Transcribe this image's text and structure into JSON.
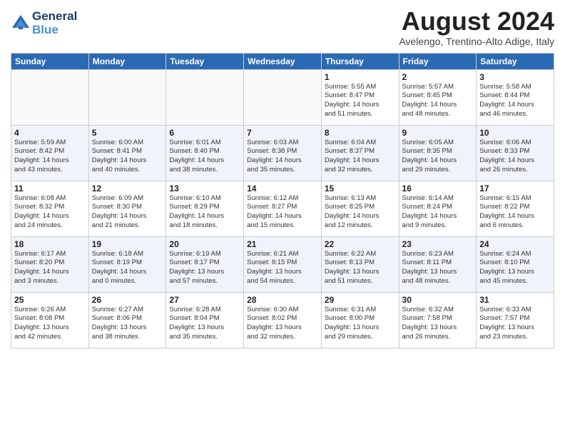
{
  "header": {
    "logo_line1": "General",
    "logo_line2": "Blue",
    "month": "August 2024",
    "location": "Avelengo, Trentino-Alto Adige, Italy"
  },
  "weekdays": [
    "Sunday",
    "Monday",
    "Tuesday",
    "Wednesday",
    "Thursday",
    "Friday",
    "Saturday"
  ],
  "weeks": [
    {
      "days": [
        {
          "num": "",
          "info": ""
        },
        {
          "num": "",
          "info": ""
        },
        {
          "num": "",
          "info": ""
        },
        {
          "num": "",
          "info": ""
        },
        {
          "num": "1",
          "info": "Sunrise: 5:55 AM\nSunset: 8:47 PM\nDaylight: 14 hours\nand 51 minutes."
        },
        {
          "num": "2",
          "info": "Sunrise: 5:57 AM\nSunset: 8:45 PM\nDaylight: 14 hours\nand 48 minutes."
        },
        {
          "num": "3",
          "info": "Sunrise: 5:58 AM\nSunset: 8:44 PM\nDaylight: 14 hours\nand 46 minutes."
        }
      ]
    },
    {
      "days": [
        {
          "num": "4",
          "info": "Sunrise: 5:59 AM\nSunset: 8:42 PM\nDaylight: 14 hours\nand 43 minutes."
        },
        {
          "num": "5",
          "info": "Sunrise: 6:00 AM\nSunset: 8:41 PM\nDaylight: 14 hours\nand 40 minutes."
        },
        {
          "num": "6",
          "info": "Sunrise: 6:01 AM\nSunset: 8:40 PM\nDaylight: 14 hours\nand 38 minutes."
        },
        {
          "num": "7",
          "info": "Sunrise: 6:03 AM\nSunset: 8:38 PM\nDaylight: 14 hours\nand 35 minutes."
        },
        {
          "num": "8",
          "info": "Sunrise: 6:04 AM\nSunset: 8:37 PM\nDaylight: 14 hours\nand 32 minutes."
        },
        {
          "num": "9",
          "info": "Sunrise: 6:05 AM\nSunset: 8:35 PM\nDaylight: 14 hours\nand 29 minutes."
        },
        {
          "num": "10",
          "info": "Sunrise: 6:06 AM\nSunset: 8:33 PM\nDaylight: 14 hours\nand 26 minutes."
        }
      ]
    },
    {
      "days": [
        {
          "num": "11",
          "info": "Sunrise: 6:08 AM\nSunset: 8:32 PM\nDaylight: 14 hours\nand 24 minutes."
        },
        {
          "num": "12",
          "info": "Sunrise: 6:09 AM\nSunset: 8:30 PM\nDaylight: 14 hours\nand 21 minutes."
        },
        {
          "num": "13",
          "info": "Sunrise: 6:10 AM\nSunset: 8:29 PM\nDaylight: 14 hours\nand 18 minutes."
        },
        {
          "num": "14",
          "info": "Sunrise: 6:12 AM\nSunset: 8:27 PM\nDaylight: 14 hours\nand 15 minutes."
        },
        {
          "num": "15",
          "info": "Sunrise: 6:13 AM\nSunset: 8:25 PM\nDaylight: 14 hours\nand 12 minutes."
        },
        {
          "num": "16",
          "info": "Sunrise: 6:14 AM\nSunset: 8:24 PM\nDaylight: 14 hours\nand 9 minutes."
        },
        {
          "num": "17",
          "info": "Sunrise: 6:15 AM\nSunset: 8:22 PM\nDaylight: 14 hours\nand 6 minutes."
        }
      ]
    },
    {
      "days": [
        {
          "num": "18",
          "info": "Sunrise: 6:17 AM\nSunset: 8:20 PM\nDaylight: 14 hours\nand 3 minutes."
        },
        {
          "num": "19",
          "info": "Sunrise: 6:18 AM\nSunset: 8:19 PM\nDaylight: 14 hours\nand 0 minutes."
        },
        {
          "num": "20",
          "info": "Sunrise: 6:19 AM\nSunset: 8:17 PM\nDaylight: 13 hours\nand 57 minutes."
        },
        {
          "num": "21",
          "info": "Sunrise: 6:21 AM\nSunset: 8:15 PM\nDaylight: 13 hours\nand 54 minutes."
        },
        {
          "num": "22",
          "info": "Sunrise: 6:22 AM\nSunset: 8:13 PM\nDaylight: 13 hours\nand 51 minutes."
        },
        {
          "num": "23",
          "info": "Sunrise: 6:23 AM\nSunset: 8:11 PM\nDaylight: 13 hours\nand 48 minutes."
        },
        {
          "num": "24",
          "info": "Sunrise: 6:24 AM\nSunset: 8:10 PM\nDaylight: 13 hours\nand 45 minutes."
        }
      ]
    },
    {
      "days": [
        {
          "num": "25",
          "info": "Sunrise: 6:26 AM\nSunset: 8:08 PM\nDaylight: 13 hours\nand 42 minutes."
        },
        {
          "num": "26",
          "info": "Sunrise: 6:27 AM\nSunset: 8:06 PM\nDaylight: 13 hours\nand 38 minutes."
        },
        {
          "num": "27",
          "info": "Sunrise: 6:28 AM\nSunset: 8:04 PM\nDaylight: 13 hours\nand 35 minutes."
        },
        {
          "num": "28",
          "info": "Sunrise: 6:30 AM\nSunset: 8:02 PM\nDaylight: 13 hours\nand 32 minutes."
        },
        {
          "num": "29",
          "info": "Sunrise: 6:31 AM\nSunset: 8:00 PM\nDaylight: 13 hours\nand 29 minutes."
        },
        {
          "num": "30",
          "info": "Sunrise: 6:32 AM\nSunset: 7:58 PM\nDaylight: 13 hours\nand 26 minutes."
        },
        {
          "num": "31",
          "info": "Sunrise: 6:33 AM\nSunset: 7:57 PM\nDaylight: 13 hours\nand 23 minutes."
        }
      ]
    }
  ]
}
